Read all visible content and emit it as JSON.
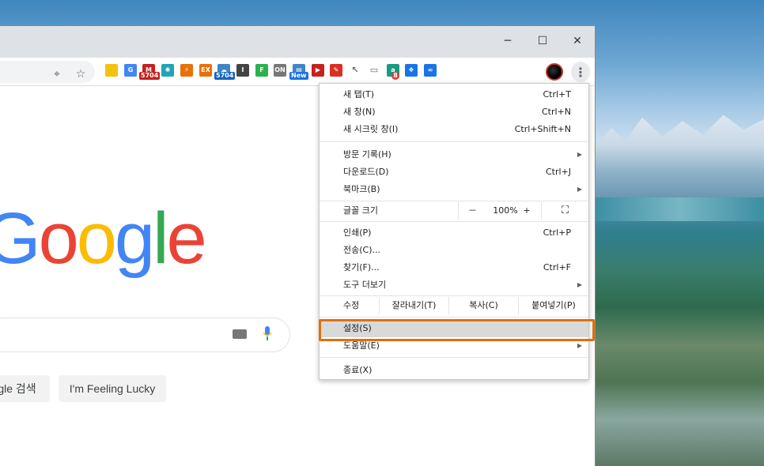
{
  "window": {
    "controls": {
      "minimize": "─",
      "maximize": "☐",
      "close": "✕"
    }
  },
  "toolbar": {
    "location_icon": "location-icon",
    "bookmark_icon": "star-icon",
    "extensions": [
      {
        "name": "memo-extension-icon",
        "color": "#f4c20d",
        "text": ""
      },
      {
        "name": "translate-extension-icon",
        "color": "#4285f4",
        "text": "G"
      },
      {
        "name": "gmail-extension-icon",
        "color": "#c5221f",
        "text": "M",
        "badge": "5704"
      },
      {
        "name": "react-extension-icon",
        "color": "#20a4b8",
        "text": "✺"
      },
      {
        "name": "flash-extension-icon",
        "color": "#e8710a",
        "text": "⚡"
      },
      {
        "name": "ex-extension-icon",
        "color": "#e8710a",
        "text": "EX"
      },
      {
        "name": "cloud-extension-icon",
        "color": "#3e85c6",
        "text": "☁",
        "badge": "5704"
      },
      {
        "name": "info-extension-icon",
        "color": "#444444",
        "text": "I"
      },
      {
        "name": "feedly-extension-icon",
        "color": "#2bb24c",
        "text": "F"
      },
      {
        "name": "onenote-extension-icon",
        "color": "#777777",
        "text": "ON"
      },
      {
        "name": "new-extension-icon",
        "color": "#3e85c6",
        "text": "▤",
        "badge": "New"
      },
      {
        "name": "video-extension-icon",
        "color": "#c5221f",
        "text": "▶"
      },
      {
        "name": "pin-extension-icon",
        "color": "#d93025",
        "text": "✎"
      },
      {
        "name": "cursor-extension-icon",
        "color": "#ffffff",
        "text": "↖"
      },
      {
        "name": "image-extension-icon",
        "color": "#ffffff",
        "text": "▭"
      },
      {
        "name": "a-extension-icon",
        "color": "#189b81",
        "text": "a",
        "badge": "8"
      },
      {
        "name": "diamond-extension-icon",
        "color": "#1a73e8",
        "text": "❖"
      },
      {
        "name": "infinity-extension-icon",
        "color": "#1a73e8",
        "text": "∞"
      }
    ]
  },
  "google": {
    "logo_letters": [
      {
        "ch": "G",
        "color": "#4285f4"
      },
      {
        "ch": "o",
        "color": "#ea4335"
      },
      {
        "ch": "o",
        "color": "#fbbc05"
      },
      {
        "ch": "g",
        "color": "#4285f4"
      },
      {
        "ch": "l",
        "color": "#34a853"
      },
      {
        "ch": "e",
        "color": "#ea4335"
      }
    ],
    "search_button": "gle 검색",
    "lucky_button": "I'm Feeling Lucky"
  },
  "menu": {
    "new_tab": {
      "label": "새 탭(T)",
      "shortcut": "Ctrl+T"
    },
    "new_window": {
      "label": "새 창(N)",
      "shortcut": "Ctrl+N"
    },
    "incognito": {
      "label": "새 시크릿 창(I)",
      "shortcut": "Ctrl+Shift+N"
    },
    "history": {
      "label": "방문 기록(H)"
    },
    "downloads": {
      "label": "다운로드(D)",
      "shortcut": "Ctrl+J"
    },
    "bookmarks": {
      "label": "북마크(B)"
    },
    "zoom": {
      "label": "글꼴 크기",
      "minus": "－",
      "value": "100%",
      "plus": "+",
      "fullscreen_icon": "fullscreen-icon"
    },
    "print": {
      "label": "인쇄(P)",
      "shortcut": "Ctrl+P"
    },
    "cast": {
      "label": "전송(C)..."
    },
    "find": {
      "label": "찾기(F)...",
      "shortcut": "Ctrl+F"
    },
    "more_tools": {
      "label": "도구 더보기"
    },
    "edit": {
      "label": "수정",
      "cut": "잘라내기(T)",
      "copy": "복사(C)",
      "paste": "붙여넣기(P)"
    },
    "settings": {
      "label": "설정(S)"
    },
    "help": {
      "label": "도움말(E)"
    },
    "exit": {
      "label": "종료(X)"
    }
  },
  "colors": {
    "annotation_border": "#e0700a",
    "menu_highlight": "#d9d9d9"
  }
}
